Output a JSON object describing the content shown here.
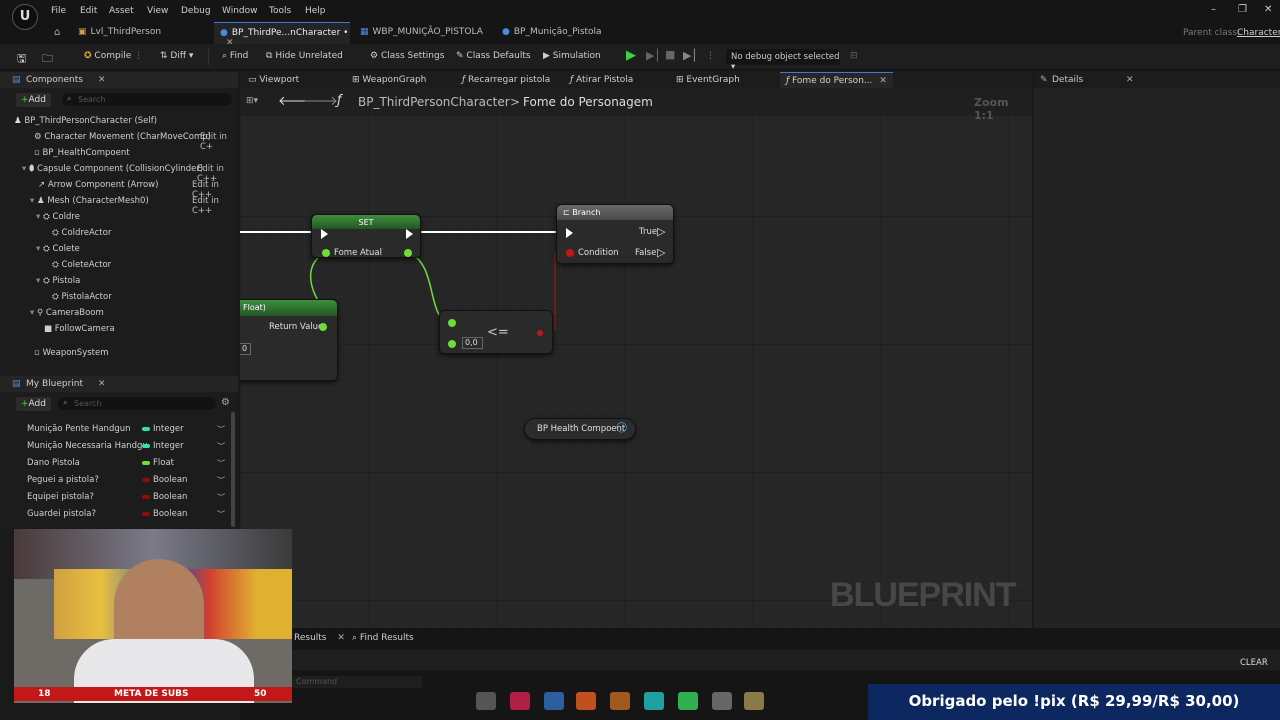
{
  "menu": [
    "File",
    "Edit",
    "Asset",
    "View",
    "Debug",
    "Window",
    "Tools",
    "Help"
  ],
  "tabs": [
    {
      "label": "Lvl_ThirdPerson"
    },
    {
      "label": "BP_ThirdPe...nCharacter •"
    },
    {
      "label": "WBP_MUNIÇÃO_PISTOLA"
    },
    {
      "label": "BP_Munição_Pistola"
    }
  ],
  "parent_class": {
    "label": "Parent class:",
    "value": "Character"
  },
  "toolbar": {
    "compile": "Compile",
    "diff": "Diff",
    "find": "Find",
    "hide_unrelated": "Hide Unrelated",
    "class_settings": "Class Settings",
    "class_defaults": "Class Defaults",
    "simulation": "Simulation",
    "debug_object": "No debug object selected"
  },
  "components_panel": {
    "title": "Components",
    "add": "Add",
    "search_placeholder": "Search",
    "items": [
      {
        "label": "BP_ThirdPersonCharacter (Self)"
      },
      {
        "label": "Character Movement (CharMoveComp)",
        "edit": "Edit in C+"
      },
      {
        "label": "BP_HealthCompoent"
      },
      {
        "label": "Capsule Component (CollisionCylinder)",
        "edit": "Edit in C++"
      },
      {
        "label": "Arrow Component (Arrow)",
        "edit": "Edit in C++"
      },
      {
        "label": "Mesh (CharacterMesh0)",
        "edit": "Edit in C++"
      },
      {
        "label": "Coldre"
      },
      {
        "label": "ColdreActor"
      },
      {
        "label": "Colete"
      },
      {
        "label": "ColeteActor"
      },
      {
        "label": "Pistola"
      },
      {
        "label": "PistolaActor"
      },
      {
        "label": "CameraBoom"
      },
      {
        "label": "FollowCamera"
      },
      {
        "label": "WeaponSystem"
      }
    ]
  },
  "my_blueprint": {
    "title": "My Blueprint",
    "add": "Add",
    "search_placeholder": "Search",
    "variables": [
      {
        "name": "Munição Pente Handgun",
        "type": "Integer",
        "color": "#2fe0b0"
      },
      {
        "name": "Munição Necessaria Handgu",
        "type": "Integer",
        "color": "#2fe0b0"
      },
      {
        "name": "Dano Pistola",
        "type": "Float",
        "color": "#6fdc3a"
      },
      {
        "name": "Peguei a pistola?",
        "type": "Boolean",
        "color": "#8f0c0c"
      },
      {
        "name": "Equipei pistola?",
        "type": "Boolean",
        "color": "#8f0c0c"
      },
      {
        "name": "Guardei pistola?",
        "type": "Boolean",
        "color": "#8f0c0c"
      }
    ]
  },
  "graph_tabs": [
    "Viewport",
    "WeaponGraph",
    "Recarregar pistola",
    "Atirar Pistola",
    "EventGraph",
    "Fome do Person..."
  ],
  "details": {
    "title": "Details"
  },
  "breadcrumb": {
    "root": "BP_ThirdPersonCharacter",
    "separator": ">",
    "current": "Fome do Personagem"
  },
  "zoom": "Zoom 1:1",
  "watermark": "BLUEPRINT",
  "nodes": {
    "set": {
      "title": "SET",
      "pin": "Fome Atual"
    },
    "branch": {
      "title": "Branch",
      "condition": "Condition",
      "true": "True",
      "false": "False"
    },
    "float_node": {
      "title": "Float)",
      "output": "Return Value",
      "value": "0"
    },
    "compare": {
      "op": "<=",
      "value": "0,0"
    },
    "health": {
      "label": "BP Health Compoent"
    }
  },
  "bottom": {
    "results": "Results",
    "find_results": "Find Results",
    "command_placeholder": "Command",
    "clear": "CLEAR"
  },
  "stream": {
    "goal_current": "18",
    "goal_label": "META DE SUBS",
    "goal_target": "50",
    "pix_message": "Obrigado pelo !pix (R$ 29,99/R$ 30,00)"
  },
  "colors": {
    "accent": "#3a7bd5",
    "exec": "#ffffff",
    "float_pin": "#6fdc3a",
    "bool_pin": "#c01818",
    "set_header": "#2e6b2e",
    "branch_header": "#5a5a5a"
  }
}
